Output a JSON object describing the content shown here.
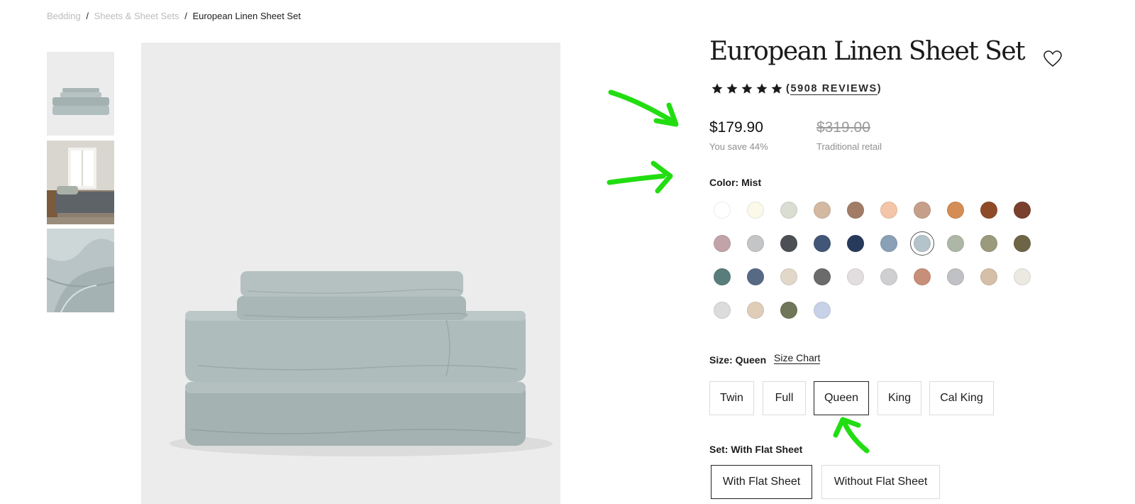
{
  "breadcrumb": {
    "items": [
      "Bedding",
      "Sheets & Sheet Sets"
    ],
    "current": "European Linen Sheet Set",
    "separator": "/"
  },
  "product": {
    "title": "European Linen Sheet Set",
    "rating_stars": 5,
    "reviews_label": "5908 REVIEWS",
    "price": "$179.90",
    "savings": "You save 44%",
    "retail_price": "$319.00",
    "retail_label": "Traditional retail"
  },
  "color": {
    "label": "Color: Mist",
    "selected_index": 16,
    "swatches": [
      "#ffffff",
      "#fbf9ea",
      "#d9ddd2",
      "#d3b8a2",
      "#a27c67",
      "#f4c5a8",
      "#c69f8a",
      "#d48d55",
      "#8f4a27",
      "#7b3f2d",
      "#c1a3a8",
      "#c4c5c7",
      "#4c4f54",
      "#425677",
      "#283a5c",
      "#8aa0b6",
      "#b5c3ca",
      "#aeb7a6",
      "#9b9a7d",
      "#6d6545",
      "#587d7b",
      "#566a84",
      "#e2d8ca",
      "#6b6b6b",
      "#e2dee0",
      "#cfcfd1",
      "#c78f77",
      "#c0c1c4",
      "#d6bfa7",
      "#ece8e2",
      "#dcdcdc",
      "#e0cdb8",
      "#6f7659",
      "#c7d2e8"
    ]
  },
  "size": {
    "label": "Size: Queen",
    "chart_link": "Size Chart",
    "options": [
      "Twin",
      "Full",
      "Queen",
      "King",
      "Cal King"
    ],
    "selected_index": 2
  },
  "set": {
    "label": "Set: With Flat Sheet",
    "options": [
      "With Flat Sheet",
      "Without Flat Sheet"
    ],
    "selected_index": 0
  },
  "colors": {
    "annotation": "#22dd11"
  }
}
